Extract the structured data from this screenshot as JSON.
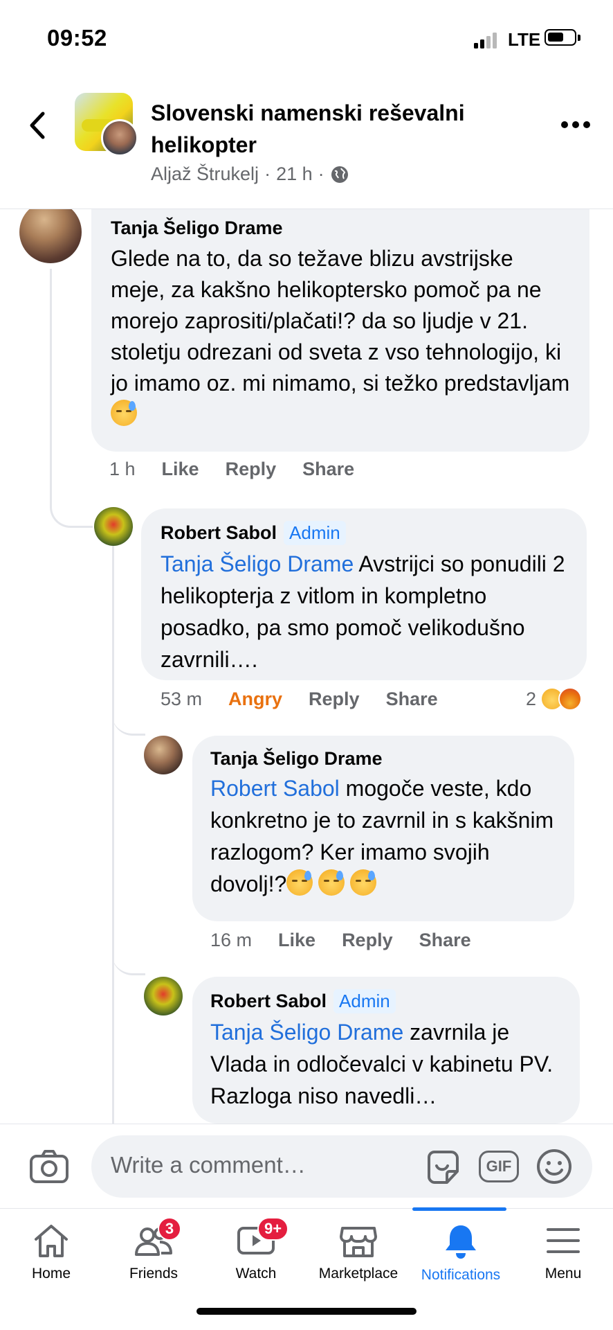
{
  "status_bar": {
    "time": "09:52",
    "network": "LTE"
  },
  "header": {
    "title": "Slovenski namenski reševalni helikopter",
    "author": "Aljaž Štrukelj",
    "time": "21 h",
    "separator": "·"
  },
  "comments": [
    {
      "author": "Tanja Šeligo Drame",
      "text": "Glede na to, da so težave blizu avstrijske meje, za kakšno helikoptersko pomoč pa ne morejo zaprositi/plačati!? da so ljudje v 21. stoletju odrezani od sveta z vso tehnologijo, ki jo imamo oz. mi nimamo, si težko predstavljam",
      "time": "1 h",
      "actions": [
        "Like",
        "Reply",
        "Share"
      ]
    },
    {
      "author": "Robert Sabol",
      "badge": "Admin",
      "mention": "Tanja Šeligo Drame",
      "text": " Avstrijci so ponudili 2 helikopterja z vitlom in kompletno posadko, pa smo pomoč velikodušno zavrnili….",
      "time": "53 m",
      "actions": [
        "Angry",
        "Reply",
        "Share"
      ],
      "reaction_count": "2"
    },
    {
      "author": "Tanja Šeligo Drame",
      "mention": "Robert Sabol",
      "text": " mogoče veste, kdo konkretno je to zavrnil in s kakšnim razlogom? Ker imamo svojih dovolj!?",
      "time": "16 m",
      "actions": [
        "Like",
        "Reply",
        "Share"
      ]
    },
    {
      "author": "Robert Sabol",
      "badge": "Admin",
      "mention": "Tanja Šeligo Drame",
      "text": " zavrnila je Vlada in odločevalci v kabinetu PV. Razloga niso navedli…"
    }
  ],
  "comment_input": {
    "placeholder": "Write a comment…",
    "gif_label": "GIF"
  },
  "tabs": [
    {
      "label": "Home",
      "icon": "home-icon"
    },
    {
      "label": "Friends",
      "icon": "friends-icon",
      "badge": "3"
    },
    {
      "label": "Watch",
      "icon": "watch-icon",
      "badge": "9+"
    },
    {
      "label": "Marketplace",
      "icon": "marketplace-icon"
    },
    {
      "label": "Notifications",
      "icon": "bell-icon",
      "active": true
    },
    {
      "label": "Menu",
      "icon": "menu-icon"
    }
  ],
  "colors": {
    "accent": "#1877f2",
    "angry": "#e9710f",
    "badge": "#e41e3f",
    "bubble": "#f0f2f5",
    "mention": "#216fdb"
  }
}
